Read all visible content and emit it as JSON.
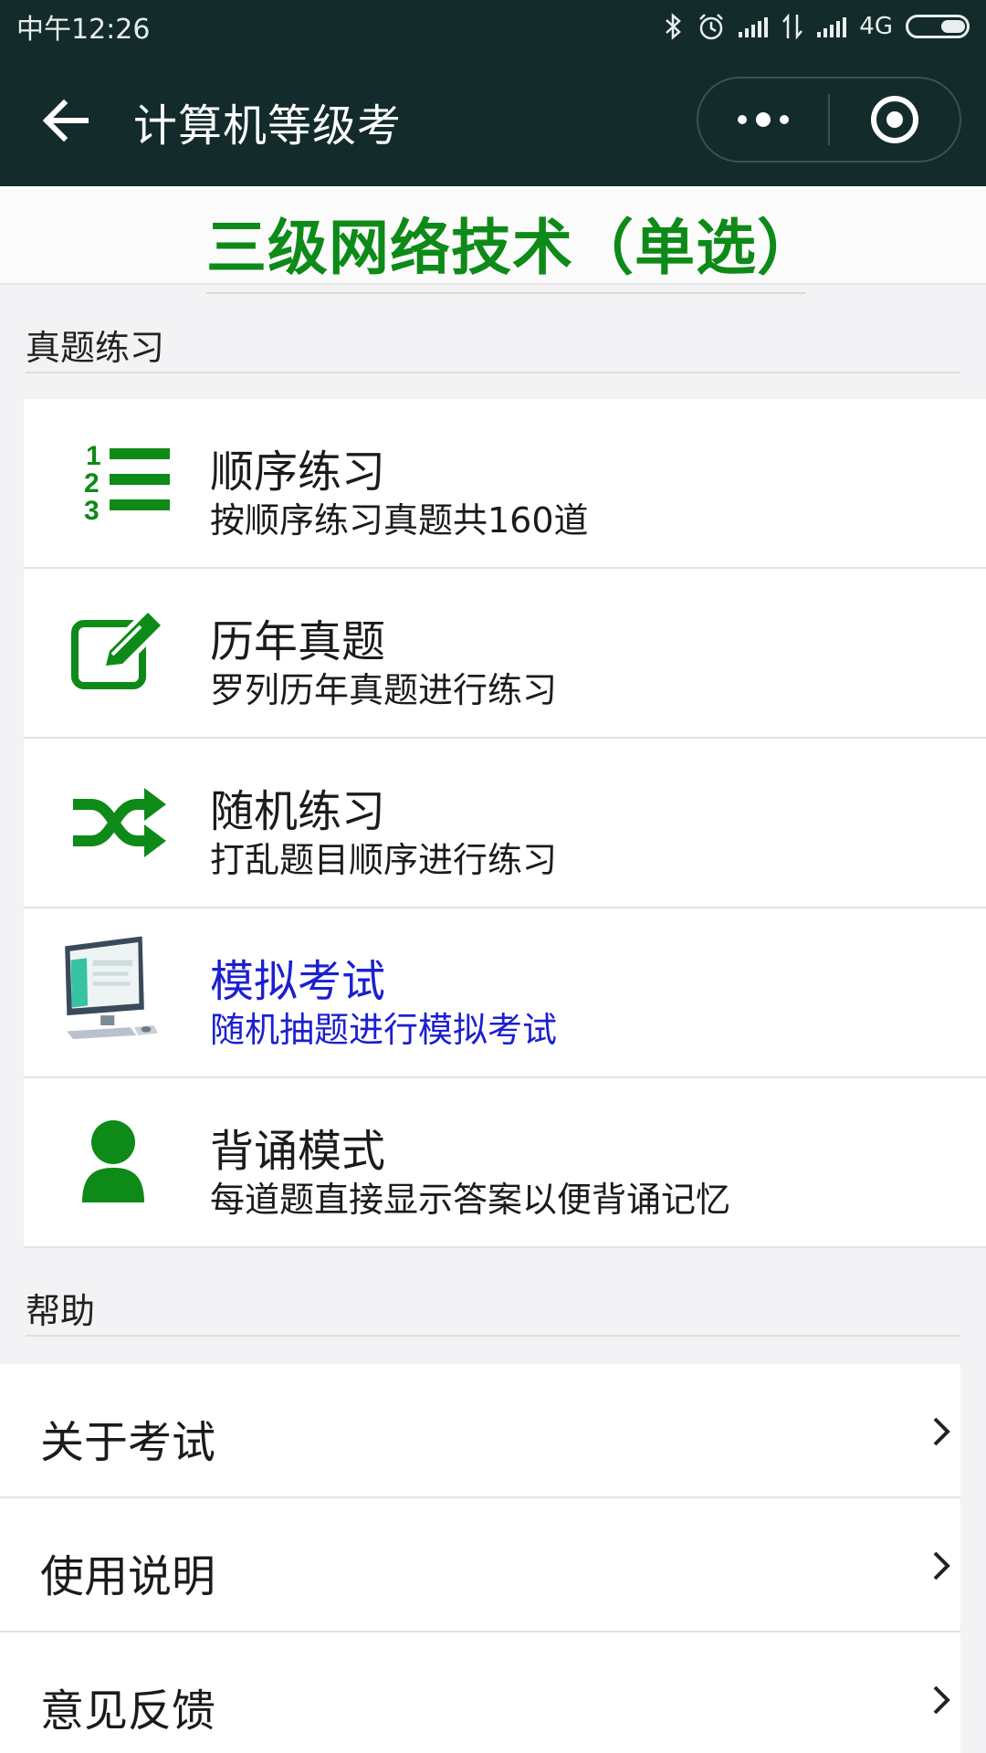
{
  "status_bar": {
    "time": "中午12:26",
    "network": "4G",
    "icons": [
      "bluetooth-icon",
      "alarm-icon",
      "signal-icon",
      "data-transfer-icon",
      "signal-icon",
      "battery-icon"
    ]
  },
  "nav": {
    "title": "计算机等级考",
    "back_icon": "arrow-left-icon",
    "more_icon": "more-dots-icon",
    "close_icon": "target-icon"
  },
  "header": {
    "title": "三级网络技术（单选）"
  },
  "colors": {
    "brand_green": "#0d8a17",
    "nav_bg": "#132b2b",
    "active_blue": "#1c1fd0"
  },
  "practice": {
    "section_label": "真题练习",
    "items": [
      {
        "icon": "ordered-list-icon",
        "title": "顺序练习",
        "desc": "按顺序练习真题共160道"
      },
      {
        "icon": "edit-icon",
        "title": "历年真题",
        "desc": "罗列历年真题进行练习"
      },
      {
        "icon": "shuffle-icon",
        "title": "随机练习",
        "desc": "打乱题目顺序进行练习"
      },
      {
        "icon": "computer-icon",
        "title": "模拟考试",
        "desc": "随机抽题进行模拟考试"
      },
      {
        "icon": "user-icon",
        "title": "背诵模式",
        "desc": "每道题直接显示答案以便背诵记忆"
      }
    ]
  },
  "help": {
    "section_label": "帮助",
    "items": [
      {
        "label": "关于考试"
      },
      {
        "label": "使用说明"
      },
      {
        "label": "意见反馈"
      }
    ]
  }
}
